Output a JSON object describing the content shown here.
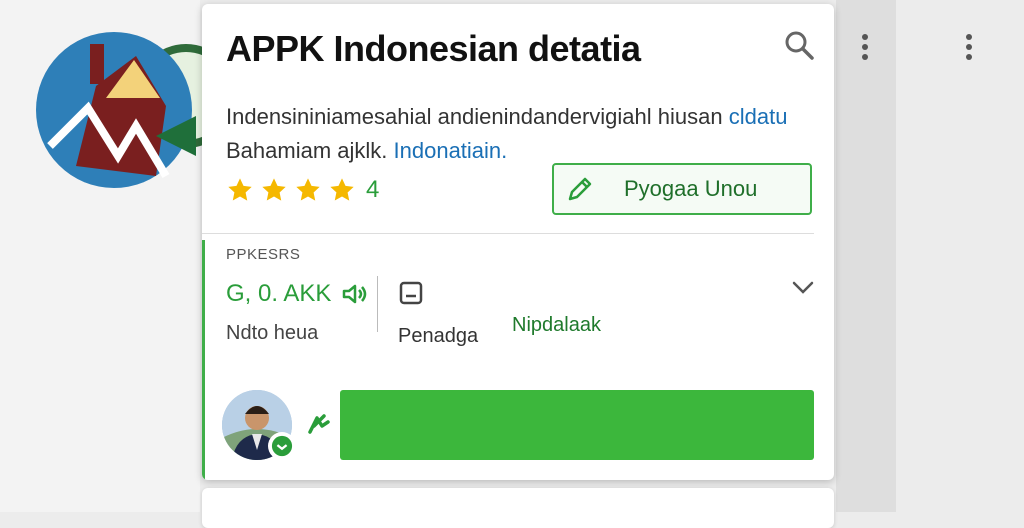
{
  "card": {
    "title": "APPK Indonesian detatia",
    "desc_line1": "Indensininiamesahial andienindandervigiahl hiusan",
    "desc_line1_link": "cldatu",
    "desc_line2": "Bahamiam ajklk.",
    "desc_line2_link": "Indonatiain.",
    "rating": "4",
    "star_count": 4,
    "primary_button": "Pyogaa Unou"
  },
  "details": {
    "section_label": "PPKESRS",
    "version_value": "G, 0. AKK",
    "version_sub": "Ndto heua",
    "col2_sub": "Penadga",
    "col3_link": "Nipdalaak"
  },
  "colors": {
    "accent_green": "#3cb73c",
    "link_blue": "#1a6fb5",
    "star_yellow": "#f5b800"
  },
  "icons": [
    "search-icon",
    "more-vert-icon",
    "edit-pencil-icon",
    "speaker-icon",
    "document-icon",
    "chevron-down-icon",
    "chat-bubble-icon",
    "hiker-icon"
  ]
}
